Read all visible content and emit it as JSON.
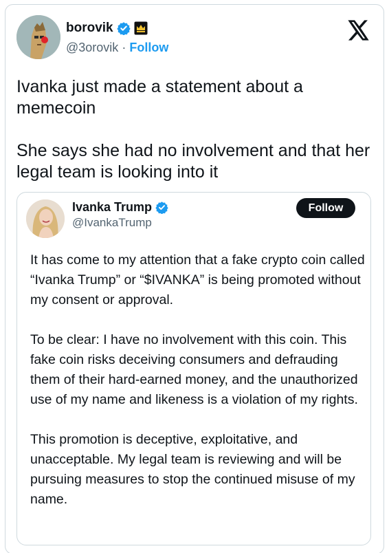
{
  "author": {
    "name": "borovik",
    "handle": "@3orovik",
    "separator": "·",
    "follow_label": "Follow",
    "avatar_icon": "pixel-punk-avatar",
    "verified_icon": "verified-badge-icon",
    "affiliate_icon": "crown-badge-icon",
    "verified_color": "#1d9bf0"
  },
  "brand": {
    "logo_icon": "x-logo-icon"
  },
  "tweet": {
    "text": "Ivanka just made a statement about a memecoin\n\nShe says she had no involvement and that her legal team is looking into it"
  },
  "quoted": {
    "name": "Ivanka Trump",
    "handle": "@IvankaTrump",
    "follow_label": "Follow",
    "avatar_icon": "profile-photo",
    "verified_icon": "verified-badge-icon",
    "paragraphs": [
      "It has come to my attention that a fake crypto coin called “Ivanka Trump” or “$IVANKA” is being promoted without my consent or approval.",
      "To be clear: I have no involvement with this coin. This fake coin risks deceiving consumers and defrauding them of their hard-earned money, and the unauthorized use of my name and likeness is a violation of my rights.",
      "This promotion is deceptive, exploitative, and unacceptable. My legal team is reviewing and will be pursuing measures to stop the continued misuse of my name."
    ]
  }
}
